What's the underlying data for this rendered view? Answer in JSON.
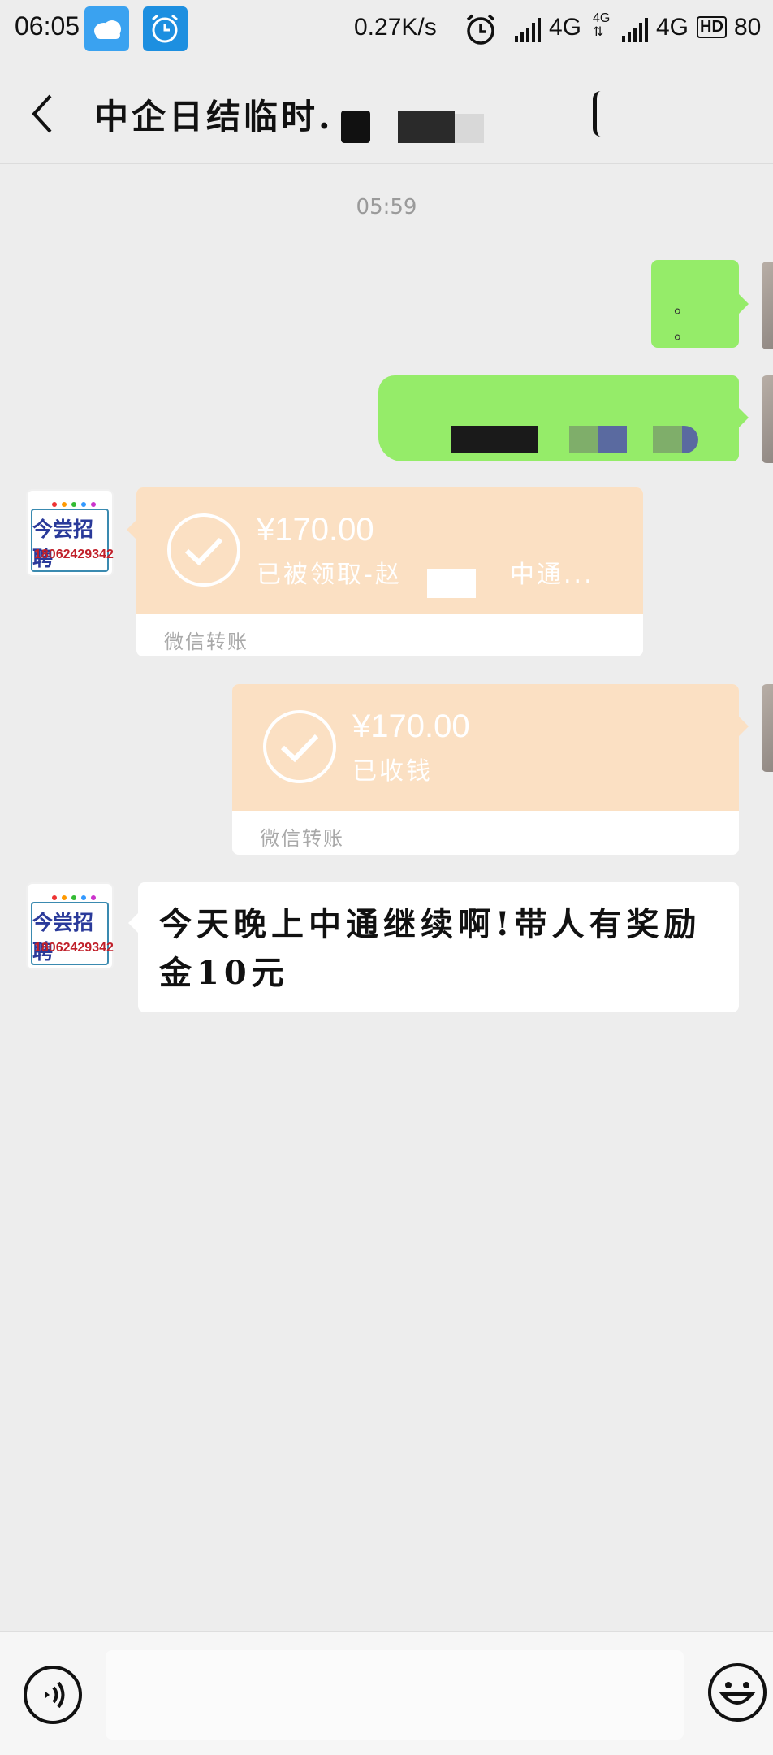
{
  "status_bar": {
    "time": "06:05",
    "net_speed": "0.27K/s",
    "network_1": "4G",
    "network_2_small": "4G",
    "network_2": "4G",
    "hd": "HD",
    "battery": "80"
  },
  "header": {
    "title": "中企日结临时."
  },
  "chat": {
    "timestamp": "05:59",
    "messages": [
      {
        "side": "right",
        "type": "text",
        "text": "。 。"
      },
      {
        "side": "right",
        "type": "text",
        "text": ""
      },
      {
        "side": "left",
        "type": "transfer",
        "amount": "¥170.00",
        "status": "已被领取-赵",
        "status_suffix": "中通...",
        "footer": "微信转账"
      },
      {
        "side": "right",
        "type": "transfer",
        "amount": "¥170.00",
        "status": "已收钱",
        "footer": "微信转账"
      },
      {
        "side": "left",
        "type": "text",
        "text": "今天晚上中通继续啊!带人有奖励金10元"
      }
    ]
  },
  "contact_avatar": {
    "title": "今尝招聘",
    "phone": "18062429342"
  },
  "icons": {
    "back": "chevron-left-icon",
    "voice": "voice-icon",
    "emoji": "emoji-icon",
    "check": "check-icon"
  },
  "colors": {
    "background": "#ededed",
    "self_bubble": "#95ec69",
    "transfer_bubble": "#fbe0c3",
    "other_bubble": "#ffffff"
  }
}
